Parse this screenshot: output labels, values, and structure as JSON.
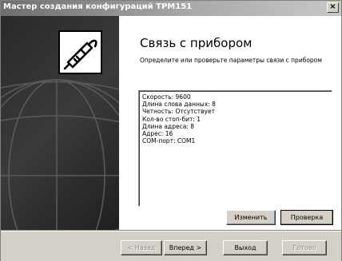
{
  "window": {
    "title": "Мастер создания конфигураций ТРМ151",
    "close_glyph": "×"
  },
  "icons": {
    "wizard_icon": "phone-cable-icon",
    "background": "globe-icon"
  },
  "main": {
    "heading": "Связь с прибором",
    "description": "Определите или проверьте параметры связи с прибором",
    "info_lines": [
      "Скорость: 9600",
      "Длина слова данных: 8",
      "Четность: Отсутствует",
      "Кол-во стоп-бит: 1",
      "Длина адреса: 8",
      "Адрес: 16",
      "COM-порт: COM1"
    ],
    "change_button": "Изменить",
    "check_button": "Проверка"
  },
  "footer": {
    "back_button": "< Назад",
    "next_button": "Вперед >",
    "exit_button": "Выход",
    "finish_button": "Готово"
  }
}
